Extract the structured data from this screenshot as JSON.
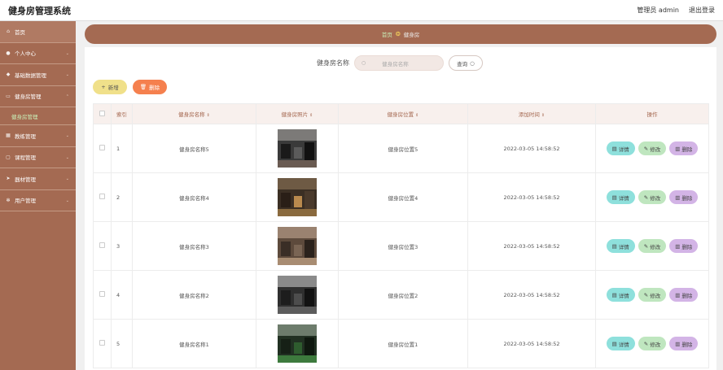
{
  "header": {
    "title": "健身房管理系统",
    "user": "管理员 admin",
    "logout": "退出登录"
  },
  "sidebar": {
    "items": [
      {
        "label": "首页",
        "icon": "home-icon"
      },
      {
        "label": "个人中心",
        "icon": "user-icon"
      },
      {
        "label": "基础数据管理",
        "icon": "gem-icon"
      },
      {
        "label": "健身房管理",
        "icon": "monitor-icon",
        "sub": "健身房管理"
      },
      {
        "label": "教练管理",
        "icon": "grid-icon"
      },
      {
        "label": "课程管理",
        "icon": "chat-icon"
      },
      {
        "label": "器材管理",
        "icon": "send-icon"
      },
      {
        "label": "用户管理",
        "icon": "settings-icon"
      }
    ]
  },
  "breadcrumb": {
    "home": "首页",
    "current": "健身房"
  },
  "search": {
    "label": "健身房名称",
    "placeholder": "健身房名称",
    "button": "查询"
  },
  "actions": {
    "add": "新增",
    "delete": "删除"
  },
  "table": {
    "columns": [
      "索引",
      "健身房名称",
      "健身房照片",
      "健身房位置",
      "添加时间",
      "操作"
    ],
    "rows": [
      {
        "index": "1",
        "name": "健身房名称5",
        "location": "健身房位置5",
        "time": "2022-03-05 14:58:52"
      },
      {
        "index": "2",
        "name": "健身房名称4",
        "location": "健身房位置4",
        "time": "2022-03-05 14:58:52"
      },
      {
        "index": "3",
        "name": "健身房名称3",
        "location": "健身房位置3",
        "time": "2022-03-05 14:58:52"
      },
      {
        "index": "4",
        "name": "健身房名称2",
        "location": "健身房位置2",
        "time": "2022-03-05 14:58:52"
      },
      {
        "index": "5",
        "name": "健身房名称1",
        "location": "健身房位置1",
        "time": "2022-03-05 14:58:52"
      }
    ],
    "row_actions": {
      "detail": "详情",
      "edit": "修改",
      "remove": "删除"
    }
  },
  "colors": {
    "sidebar": "#a46a52",
    "accent": "#a3664e",
    "active_sub": "#c9f0b8"
  }
}
